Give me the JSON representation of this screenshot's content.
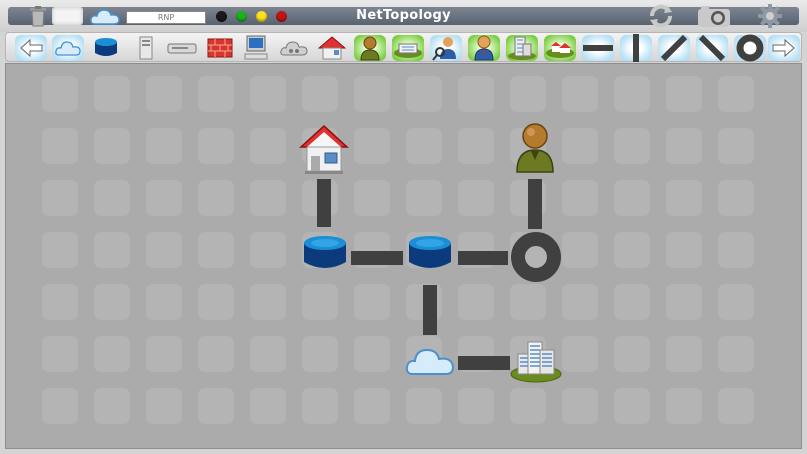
{
  "app": {
    "title": "NetTopology",
    "network_name": "RNP"
  },
  "titlebar": {
    "icons": [
      "trash-icon",
      "blank-document-icon",
      "cloud-icon",
      "refresh-icon",
      "camera-icon",
      "gear-icon"
    ],
    "status_lights": [
      {
        "name": "black",
        "color": "#1a1a1a"
      },
      {
        "name": "green",
        "color": "#1db01d"
      },
      {
        "name": "yellow",
        "color": "#ffe21a"
      },
      {
        "name": "red",
        "color": "#c01515"
      }
    ]
  },
  "toolbar": {
    "tools": [
      "back-arrow",
      "cloud",
      "database",
      "server-tower",
      "router",
      "firewall",
      "workstation",
      "cloud-cluster",
      "house",
      "user",
      "building-green",
      "user-search",
      "user-admin",
      "office-tower",
      "village",
      "link-horizontal",
      "link-vertical",
      "link-diagonal-up",
      "link-diagonal-down",
      "ring",
      "forward-arrow"
    ]
  },
  "canvas": {
    "nodes": [
      "house",
      "user",
      "database-1",
      "database-2",
      "ring",
      "cloud",
      "office-building"
    ],
    "links": [
      {
        "from": "house",
        "to": "database-1"
      },
      {
        "from": "database-1",
        "to": "database-2"
      },
      {
        "from": "database-2",
        "to": "ring"
      },
      {
        "from": "user",
        "to": "ring"
      },
      {
        "from": "database-2",
        "to": "cloud"
      },
      {
        "from": "cloud",
        "to": "office-building"
      }
    ]
  },
  "colors": {
    "toolbar_selected": "#bfe4f6",
    "toolbar_green": "#7ccd45",
    "link": "#404040",
    "canvas": "#ababab"
  }
}
